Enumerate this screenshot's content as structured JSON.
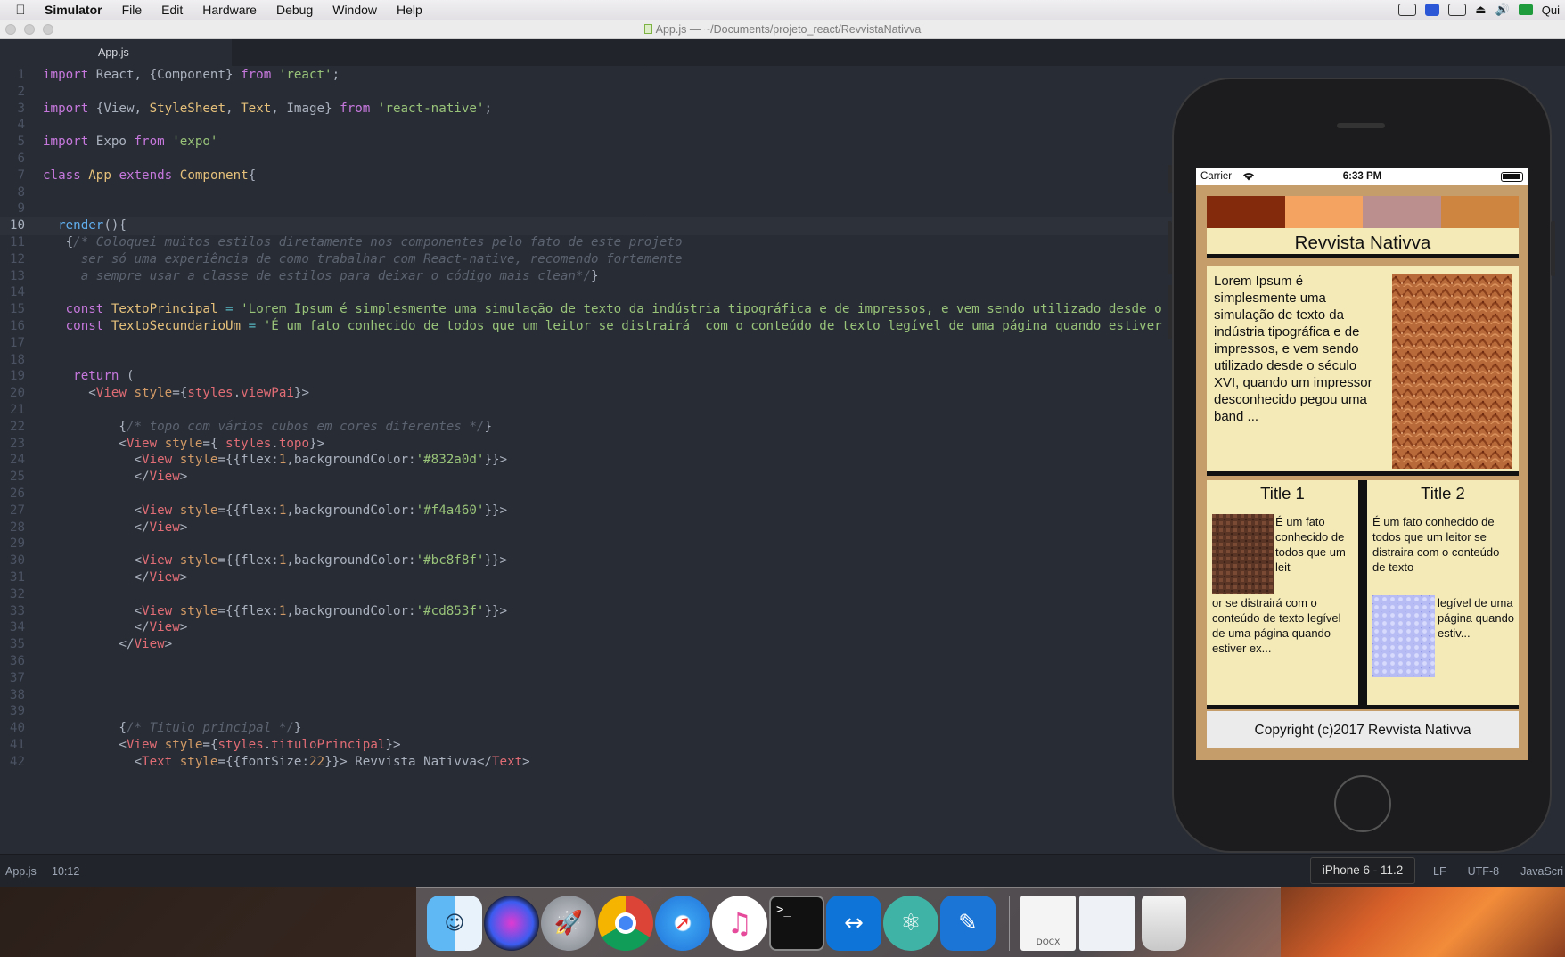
{
  "menubar": {
    "app_name": "Simulator",
    "items": [
      "File",
      "Edit",
      "Hardware",
      "Debug",
      "Window",
      "Help"
    ],
    "right_text": "Qui"
  },
  "window": {
    "title": "App.js — ~/Documents/projeto_react/RevvistaNativva",
    "tab": "App.js"
  },
  "editor": {
    "current_line": 10,
    "lines": [
      [
        [
          "k",
          "import"
        ],
        [
          "p",
          " React, {Component} "
        ],
        [
          "k",
          "from"
        ],
        [
          "p",
          " "
        ],
        [
          "s",
          "'react'"
        ],
        [
          "p",
          ";"
        ]
      ],
      [],
      [
        [
          "k",
          "import"
        ],
        [
          "p",
          " {View, "
        ],
        [
          "t",
          "StyleSheet"
        ],
        [
          "p",
          ", "
        ],
        [
          "t",
          "Text"
        ],
        [
          "p",
          ", Image} "
        ],
        [
          "k",
          "from"
        ],
        [
          "p",
          " "
        ],
        [
          "s",
          "'react-native'"
        ],
        [
          "p",
          ";"
        ]
      ],
      [],
      [
        [
          "k",
          "import"
        ],
        [
          "p",
          " Expo "
        ],
        [
          "k",
          "from"
        ],
        [
          "p",
          " "
        ],
        [
          "s",
          "'expo'"
        ]
      ],
      [],
      [
        [
          "k",
          "class"
        ],
        [
          "p",
          " "
        ],
        [
          "t",
          "App"
        ],
        [
          "p",
          " "
        ],
        [
          "k",
          "extends"
        ],
        [
          "p",
          " "
        ],
        [
          "t",
          "Component"
        ],
        [
          "p",
          "{"
        ]
      ],
      [],
      [],
      [
        [
          "p",
          "  "
        ],
        [
          "f",
          "render"
        ],
        [
          "p",
          "(){"
        ]
      ],
      [
        [
          "p",
          "   {"
        ],
        [
          "c",
          "/* Coloquei muitos estilos diretamente nos componentes pelo fato de este projeto"
        ]
      ],
      [
        [
          "c",
          "     ser só uma experiência de como trabalhar com React-native, recomendo fortemente"
        ]
      ],
      [
        [
          "c",
          "     a sempre usar a classe de estilos para deixar o código mais clean*/"
        ],
        [
          "p",
          "}"
        ]
      ],
      [],
      [
        [
          "p",
          "   "
        ],
        [
          "k",
          "const"
        ],
        [
          "p",
          " "
        ],
        [
          "t",
          "TextoPrincipal"
        ],
        [
          "p",
          " "
        ],
        [
          "o",
          "="
        ],
        [
          "p",
          " "
        ],
        [
          "s",
          "'Lorem Ipsum é simplesmente uma simulação de texto da indústria tipográfica e de impressos, e vem sendo utilizado desde o século XVI, quando um impressor desconhecido pegou uma"
        ]
      ],
      [
        [
          "p",
          "   "
        ],
        [
          "k",
          "const"
        ],
        [
          "p",
          " "
        ],
        [
          "t",
          "TextoSecundarioUm"
        ],
        [
          "p",
          " "
        ],
        [
          "o",
          "="
        ],
        [
          "p",
          " "
        ],
        [
          "s",
          "'É um fato conhecido de todos que um leitor se distrairá  com o conteúdo de texto legível de uma página quando estiver examinando sua diagramação."
        ]
      ],
      [],
      [],
      [
        [
          "p",
          "    "
        ],
        [
          "k",
          "return"
        ],
        [
          "p",
          " ("
        ]
      ],
      [
        [
          "p",
          "      <"
        ],
        [
          "r",
          "View"
        ],
        [
          "p",
          " "
        ],
        [
          "n",
          "style"
        ],
        [
          "p",
          "={"
        ],
        [
          "r",
          "styles"
        ],
        [
          "p",
          "."
        ],
        [
          "r",
          "viewPai"
        ],
        [
          "p",
          "}>"
        ]
      ],
      [],
      [
        [
          "p",
          "          {"
        ],
        [
          "c",
          "/* topo com vários cubos em cores diferentes */"
        ],
        [
          "p",
          "}"
        ]
      ],
      [
        [
          "p",
          "          <"
        ],
        [
          "r",
          "View"
        ],
        [
          "p",
          " "
        ],
        [
          "n",
          "style"
        ],
        [
          "p",
          "={ "
        ],
        [
          "r",
          "styles"
        ],
        [
          "p",
          "."
        ],
        [
          "r",
          "topo"
        ],
        [
          "p",
          "}>"
        ]
      ],
      [
        [
          "p",
          "            <"
        ],
        [
          "r",
          "View"
        ],
        [
          "p",
          " "
        ],
        [
          "n",
          "style"
        ],
        [
          "p",
          "={{flex:"
        ],
        [
          "n",
          "1"
        ],
        [
          "p",
          ",backgroundColor:"
        ],
        [
          "s",
          "'#832a0d'"
        ],
        [
          "p",
          "}}>"
        ]
      ],
      [
        [
          "p",
          "            </"
        ],
        [
          "r",
          "View"
        ],
        [
          "p",
          ">"
        ]
      ],
      [],
      [
        [
          "p",
          "            <"
        ],
        [
          "r",
          "View"
        ],
        [
          "p",
          " "
        ],
        [
          "n",
          "style"
        ],
        [
          "p",
          "={{flex:"
        ],
        [
          "n",
          "1"
        ],
        [
          "p",
          ",backgroundColor:"
        ],
        [
          "s",
          "'#f4a460'"
        ],
        [
          "p",
          "}}>"
        ]
      ],
      [
        [
          "p",
          "            </"
        ],
        [
          "r",
          "View"
        ],
        [
          "p",
          ">"
        ]
      ],
      [],
      [
        [
          "p",
          "            <"
        ],
        [
          "r",
          "View"
        ],
        [
          "p",
          " "
        ],
        [
          "n",
          "style"
        ],
        [
          "p",
          "={{flex:"
        ],
        [
          "n",
          "1"
        ],
        [
          "p",
          ",backgroundColor:"
        ],
        [
          "s",
          "'#bc8f8f'"
        ],
        [
          "p",
          "}}>"
        ]
      ],
      [
        [
          "p",
          "            </"
        ],
        [
          "r",
          "View"
        ],
        [
          "p",
          ">"
        ]
      ],
      [],
      [
        [
          "p",
          "            <"
        ],
        [
          "r",
          "View"
        ],
        [
          "p",
          " "
        ],
        [
          "n",
          "style"
        ],
        [
          "p",
          "={{flex:"
        ],
        [
          "n",
          "1"
        ],
        [
          "p",
          ",backgroundColor:"
        ],
        [
          "s",
          "'#cd853f'"
        ],
        [
          "p",
          "}}>"
        ]
      ],
      [
        [
          "p",
          "            </"
        ],
        [
          "r",
          "View"
        ],
        [
          "p",
          ">"
        ]
      ],
      [
        [
          "p",
          "          </"
        ],
        [
          "r",
          "View"
        ],
        [
          "p",
          ">"
        ]
      ],
      [],
      [],
      [],
      [],
      [
        [
          "p",
          "          {"
        ],
        [
          "c",
          "/* Titulo principal */"
        ],
        [
          "p",
          "}"
        ]
      ],
      [
        [
          "p",
          "          <"
        ],
        [
          "r",
          "View"
        ],
        [
          "p",
          " "
        ],
        [
          "n",
          "style"
        ],
        [
          "p",
          "={"
        ],
        [
          "r",
          "styles"
        ],
        [
          "p",
          "."
        ],
        [
          "r",
          "tituloPrincipal"
        ],
        [
          "p",
          "}>"
        ]
      ],
      [
        [
          "p",
          "            <"
        ],
        [
          "r",
          "Text"
        ],
        [
          "p",
          " "
        ],
        [
          "n",
          "style"
        ],
        [
          "p",
          "={{fontSize:"
        ],
        [
          "n",
          "22"
        ],
        [
          "p",
          "}}> Revvista Nativva</"
        ],
        [
          "r",
          "Text"
        ],
        [
          "p",
          ">"
        ]
      ]
    ]
  },
  "status": {
    "file": "App.js",
    "position": "10:12",
    "line_ending": "LF",
    "encoding": "UTF-8",
    "grammar": "JavaScri"
  },
  "simulator": {
    "device_label": "iPhone 6 - 11.2",
    "carrier": "Carrier",
    "time": "6:33 PM",
    "cube_colors": [
      "#832a0d",
      "#f4a460",
      "#bc8f8f",
      "#cd853f"
    ],
    "app_title": "Revvista Nativva",
    "main_text": "Lorem Ipsum é simplesmente uma simulação de texto da indústria tipográfica e de impressos, e vem sendo utilizado desde o século XVI, quando um impressor desconhecido pegou uma band ...",
    "col1": {
      "title": "Title 1",
      "text_right": "É um fato conhecido de todos que um leit",
      "text_below": "or se distrairá  com o conteúdo de texto legível de uma página quando estiver ex..."
    },
    "col2": {
      "title": "Title 2",
      "text_top": "É um fato conhecido de todos que um leitor se distraira  com o conteúdo de texto",
      "text_right": "legível de uma página quando estiv..."
    },
    "footer": "Copyright (c)2017 Revvista Nativva"
  },
  "dock": {
    "apps": [
      "finder-icon",
      "siri-icon",
      "launchpad-icon",
      "chrome-icon",
      "safari-icon",
      "itunes-icon",
      "terminal-icon",
      "teamviewer-icon",
      "atom-icon",
      "xcode-simulator-icon",
      "docx-file-icon",
      "document-stack-icon",
      "trash-icon"
    ],
    "docx_label": "DOCX"
  }
}
